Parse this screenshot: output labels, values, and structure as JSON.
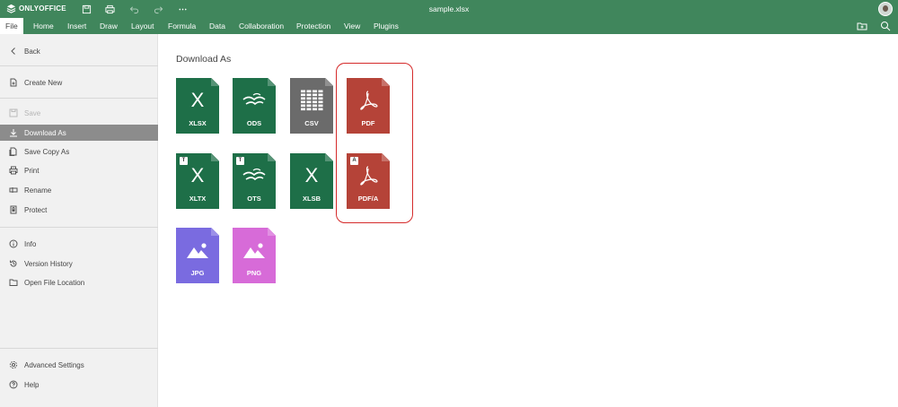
{
  "app": {
    "logo": "ONLYOFFICE",
    "doc_title": "sample.xlsx"
  },
  "menu": {
    "tabs": [
      "File",
      "Home",
      "Insert",
      "Draw",
      "Layout",
      "Formula",
      "Data",
      "Collaboration",
      "Protection",
      "View",
      "Plugins"
    ],
    "active": "File"
  },
  "sidebar": {
    "back": "Back",
    "create_new": "Create New",
    "save": "Save",
    "download_as": "Download As",
    "save_copy_as": "Save Copy As",
    "print": "Print",
    "rename": "Rename",
    "protect": "Protect",
    "info": "Info",
    "version_history": "Version History",
    "open_file_location": "Open File Location",
    "advanced_settings": "Advanced Settings",
    "help": "Help"
  },
  "panel": {
    "title": "Download As",
    "formats": [
      {
        "label": "XLSX",
        "color": "#1e6f48",
        "glyph": "x-icon",
        "badge": ""
      },
      {
        "label": "ODS",
        "color": "#1e6f48",
        "glyph": "seagull-icon",
        "badge": ""
      },
      {
        "label": "CSV",
        "color": "#6b6b6b",
        "glyph": "grid-icon",
        "badge": ""
      },
      {
        "label": "PDF",
        "color": "#b54338",
        "glyph": "acrobat-icon",
        "badge": ""
      },
      {
        "label": "XLTX",
        "color": "#1e6f48",
        "glyph": "x-icon",
        "badge": "T"
      },
      {
        "label": "OTS",
        "color": "#1e6f48",
        "glyph": "seagull-icon",
        "badge": "T"
      },
      {
        "label": "XLSB",
        "color": "#1e6f48",
        "glyph": "x-icon",
        "badge": ""
      },
      {
        "label": "PDF/A",
        "color": "#b54338",
        "glyph": "acrobat-icon",
        "badge": "A"
      },
      {
        "label": "JPG",
        "color": "#7a6be0",
        "glyph": "image-icon",
        "badge": ""
      },
      {
        "label": "PNG",
        "color": "#d76bd8",
        "glyph": "image-icon",
        "badge": ""
      }
    ]
  }
}
